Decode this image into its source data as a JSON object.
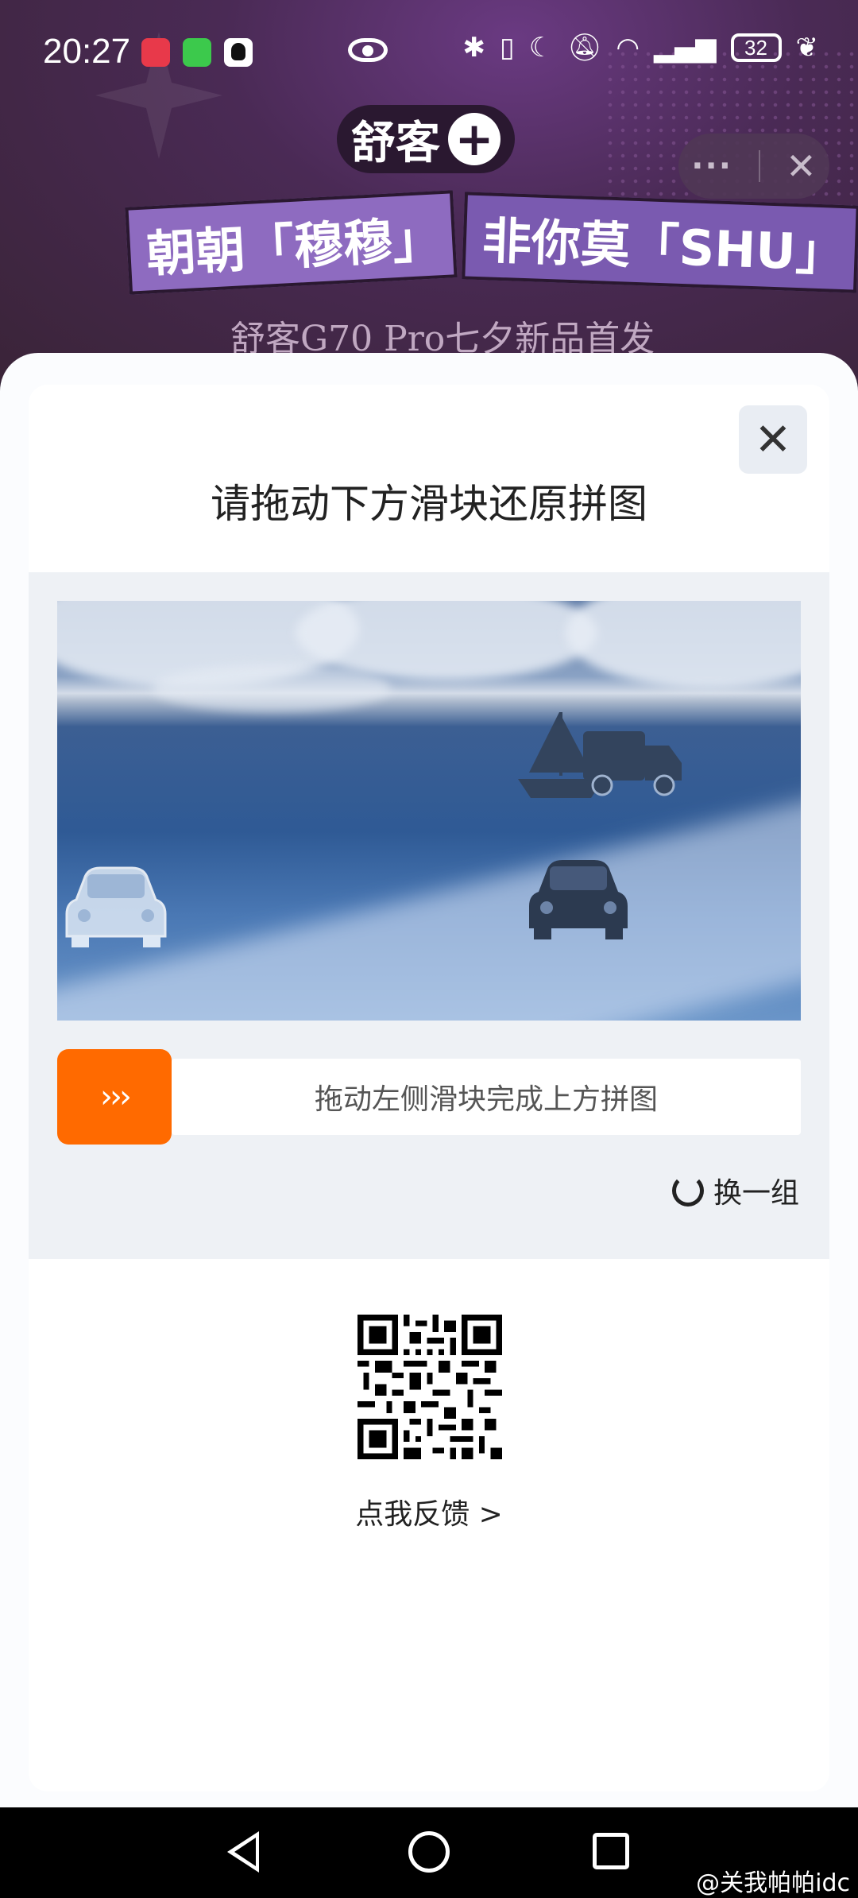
{
  "status_bar": {
    "time": "20:27",
    "battery": "32"
  },
  "banner": {
    "logo_text": "舒客",
    "logo_plus": "+",
    "slogan_left": "朝朝「穆穆」",
    "slogan_right": "非你莫「SHU」",
    "sub_slogan": "舒客G70 Pro七夕新品首发"
  },
  "top_actions": {
    "more": "···",
    "close": "✕"
  },
  "captcha": {
    "close": "✕",
    "title": "请拖动下方滑块还原拼图",
    "slider_hint": "拖动左侧滑块完成上方拼图",
    "slider_arrows": "›››",
    "refresh_label": "换一组",
    "feedback_label": "点我反馈 >"
  },
  "colors": {
    "accent": "#ff6a00",
    "panel_bg": "#eef1f5"
  },
  "watermark": "@关我帕帕idc"
}
